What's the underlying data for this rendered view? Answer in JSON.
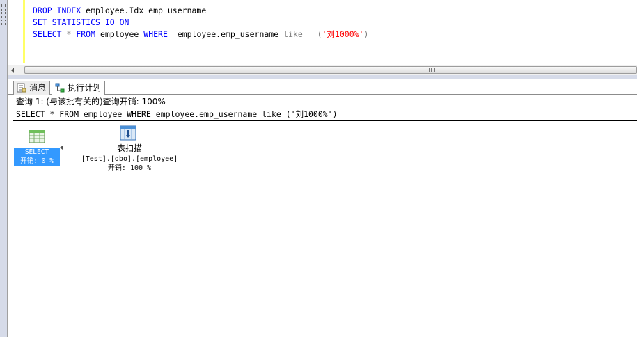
{
  "editor": {
    "line1": {
      "kw": "DROP INDEX",
      "rest": " employee.Idx_emp_username"
    },
    "line2": {
      "kw": "SET STATISTICS IO ON"
    },
    "line3": {
      "kw1": "SELECT",
      "star": " * ",
      "kw2": "FROM",
      "t1": " employee ",
      "kw3": "WHERE",
      "t2": "  employee.emp_username ",
      "like": "like",
      "sp": "   ",
      "p1": "(",
      "str": "'刘1000%'",
      "p2": ")"
    }
  },
  "tabs": [
    {
      "label": "消息",
      "icon": "messages-icon"
    },
    {
      "label": "执行计划",
      "icon": "execution-plan-icon"
    }
  ],
  "results": {
    "query_header": "查询 1: (与该批有关的)查询开销: 100%",
    "query_text": "SELECT * FROM employee WHERE employee.emp_username like ('刘1000%')"
  },
  "plan": {
    "select_node": {
      "label": "SELECT",
      "cost": "开销: 0 %"
    },
    "scan_node": {
      "name": "表扫描",
      "object": "[Test].[dbo].[employee]",
      "cost": "开销: 100 %"
    }
  },
  "colors": {
    "keyword": "#0000ff",
    "string": "#ff0000",
    "selection": "#3399ff"
  }
}
